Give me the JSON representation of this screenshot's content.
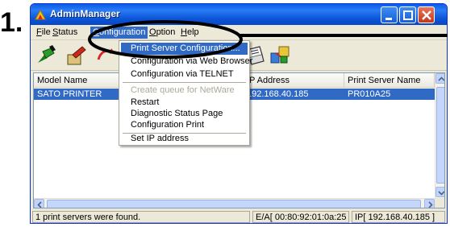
{
  "step_label": "1.",
  "window": {
    "title": "AdminManager"
  },
  "menubar": {
    "items": [
      {
        "label": "File",
        "mnemonic": "F",
        "rest": "ile"
      },
      {
        "label": "Status",
        "mnemonic": "S",
        "rest": "tatus"
      },
      {
        "label": "Configuration",
        "mnemonic": "C",
        "rest": "onfiguration"
      },
      {
        "label": "Option",
        "mnemonic": "O",
        "rest": "ption"
      },
      {
        "label": "Help",
        "mnemonic": "H",
        "rest": "elp"
      }
    ],
    "active": "Configuration"
  },
  "configuration_menu": {
    "items": [
      {
        "label": "Print Server Configuration...",
        "state": "highlighted"
      },
      {
        "label": "Configuration via Web Browser",
        "state": "normal"
      },
      {
        "label": "Configuration via TELNET",
        "state": "normal"
      },
      {
        "label": "Create queue for NetWare",
        "state": "disabled"
      },
      {
        "label": "Restart",
        "state": "normal"
      },
      {
        "label": "Diagnostic Status Page",
        "state": "normal"
      },
      {
        "label": "Configuration Print",
        "state": "normal"
      },
      {
        "label": "Set IP address",
        "state": "normal"
      }
    ]
  },
  "toolbar": {
    "buttons": [
      "search-icon",
      "settings-icon",
      "refresh-icon",
      "web-icon",
      "telnet-icon",
      "diagnostic-icon",
      "print-config-icon",
      "set-ip-icon"
    ]
  },
  "list": {
    "columns": [
      "Model Name",
      "IP Address",
      "Print Server Name"
    ],
    "rows": [
      {
        "model": "SATO PRINTER",
        "ip": "192.168.40.185",
        "server": "PR010A25",
        "selected": true
      }
    ]
  },
  "statusbar": {
    "message": "1 print servers were found.",
    "mac": "E/A[ 00:80:92:01:0a:25 ]",
    "ip": "IP[ 192.168.40.185 ]"
  },
  "colors": {
    "title_blue": "#0a5ce6",
    "selection": "#316ac5",
    "window_face": "#ece9d8",
    "callout": "#000000"
  }
}
